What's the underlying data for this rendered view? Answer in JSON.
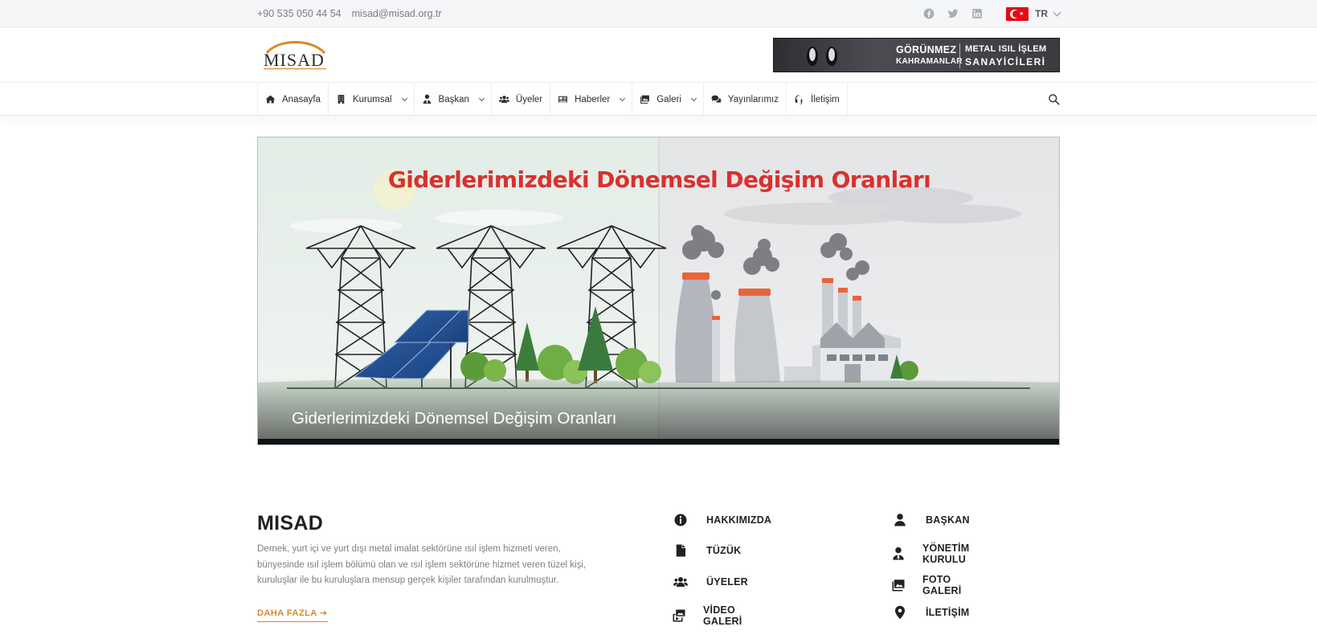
{
  "topbar": {
    "phone": "+90 535 050 44 54",
    "email": "misad@misad.org.tr",
    "social": [
      "facebook-icon",
      "twitter-icon",
      "linkedin-icon"
    ],
    "language": "TR"
  },
  "header": {
    "logo_text": "MISAD",
    "banner": {
      "line1": "GÖRÜNMEZ",
      "line2": "KAHRAMANLAR",
      "line3": "METAL ISIL İŞLEM",
      "line4": "SANAYİCİLERİ"
    }
  },
  "nav": {
    "items": [
      {
        "label": "Anasayfa",
        "icon": "home-icon",
        "dropdown": false
      },
      {
        "label": "Kurumsal",
        "icon": "building-icon",
        "dropdown": true
      },
      {
        "label": "Başkan",
        "icon": "user-tie-icon",
        "dropdown": true
      },
      {
        "label": "Üyeler",
        "icon": "users-icon",
        "dropdown": false
      },
      {
        "label": "Haberler",
        "icon": "newspaper-icon",
        "dropdown": true
      },
      {
        "label": "Galeri",
        "icon": "images-icon",
        "dropdown": true
      },
      {
        "label": "Yayınlarımız",
        "icon": "comments-icon",
        "dropdown": false
      },
      {
        "label": "İletişim",
        "icon": "headset-icon",
        "dropdown": false
      }
    ]
  },
  "hero": {
    "title": "Giderlerimizdeki Dönemsel Değişim Oranları",
    "caption": "Giderlerimizdeki Dönemsel Değişim Oranları"
  },
  "about": {
    "title": "MISAD",
    "text": "Dernek, yurt içi ve yurt dışı metal imalat sektörüne ısıl işlem hizmeti veren, bünyesinde ısıl işlem bölümü olan ve ısıl işlem sektörüne hizmet veren tüzel kişi, kuruluşlar ile bu kuruluşlara mensup gerçek kişiler tarafından kurulmuştur.",
    "more": "DAHA FAZLA ➜"
  },
  "quick_links": {
    "col1": [
      {
        "label": "HAKKIMIZDA",
        "icon": "info-circle-icon"
      },
      {
        "label": "TÜZÜK",
        "icon": "file-icon"
      },
      {
        "label": "ÜYELER",
        "icon": "users-icon"
      },
      {
        "label": "VİDEO GALERİ",
        "icon": "photo-video-icon"
      }
    ],
    "col2": [
      {
        "label": "BAŞKAN",
        "icon": "user-icon"
      },
      {
        "label": "YÖNETİM KURULU",
        "icon": "user-tie-icon"
      },
      {
        "label": "FOTO GALERİ",
        "icon": "images-icon"
      },
      {
        "label": "İLETİŞİM",
        "icon": "map-marker-icon"
      }
    ]
  },
  "colors": {
    "accent": "#d8892b",
    "hero_title": "#d9312f",
    "text_dark": "#1f2125",
    "text_muted": "#7b7e84"
  }
}
